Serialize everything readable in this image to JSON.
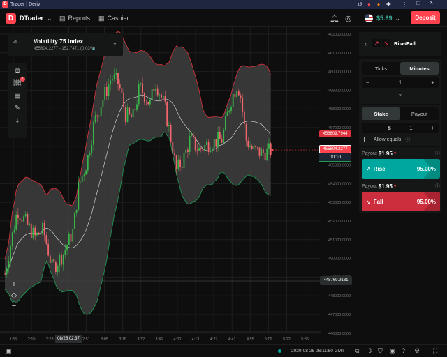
{
  "window": {
    "title": "Trader | Deriv",
    "controls": [
      "–",
      "❐",
      "X"
    ]
  },
  "header": {
    "app": "DTrader",
    "reports": "Reports",
    "cashier": "Cashier",
    "balance": "$5.69",
    "deposit": "Deposit"
  },
  "market": {
    "name": "Volatility 75 Index",
    "quote": "455804.2277 - 152.7471 (0.03%)"
  },
  "chart": {
    "y_ticks": [
      "462000.0000",
      "461000.0000",
      "460000.0000",
      "459000.0000",
      "458000.0000",
      "457000.0000",
      "456000.0000",
      "455000.0000",
      "454000.0000",
      "453000.0000",
      "452000.0000",
      "451000.0000",
      "450000.0000",
      "449000.0000",
      "448000.0000",
      "447000.0000",
      "446000.0000"
    ],
    "x_ticks": [
      "1:56",
      "2:10",
      "2:23",
      "2:37",
      "2:51",
      "3:05",
      "3:18",
      "3:32",
      "3:46",
      "4:00",
      "4:13",
      "4:27",
      "4:41",
      "4:55",
      "5:09",
      "5:22",
      "5:36"
    ],
    "upper_band_label": "456609.7944",
    "current_price": "455804.2277",
    "countdown": "00:10",
    "crosshair_price": "448769.9131",
    "crosshair_time": "08/25 02:37",
    "granularity": "1 m",
    "indicator_badge": "1",
    "colors": {
      "up": "#4bb4b3",
      "rise_candle": "#39b54a",
      "fall_candle": "#f2656d",
      "upper_band": "#e0323c",
      "lower_band": "#1f9d55",
      "mid": "#d0d0d0",
      "band_fill": "#3e3e3e"
    }
  },
  "trade": {
    "contract": "Rise/Fall",
    "duration_tabs": [
      "Ticks",
      "Minutes"
    ],
    "duration_active": "Minutes",
    "duration_value": "1",
    "amount_tabs": [
      "Stake",
      "Payout"
    ],
    "amount_active": "Stake",
    "currency": "$",
    "stake_value": "1",
    "allow_equals": "Allow equals",
    "rise": {
      "payout_label": "Payout",
      "payout": "$1.95",
      "label": "Rise",
      "percent": "95.00%",
      "color": "#00a79e"
    },
    "fall": {
      "payout_label": "Payout",
      "payout": "$1.95",
      "label": "Fall",
      "percent": "95.00%",
      "color": "#cc2e3d"
    }
  },
  "footer": {
    "status_color": "#00a79e",
    "time": "2020-08-25 06:11:50 GMT"
  }
}
